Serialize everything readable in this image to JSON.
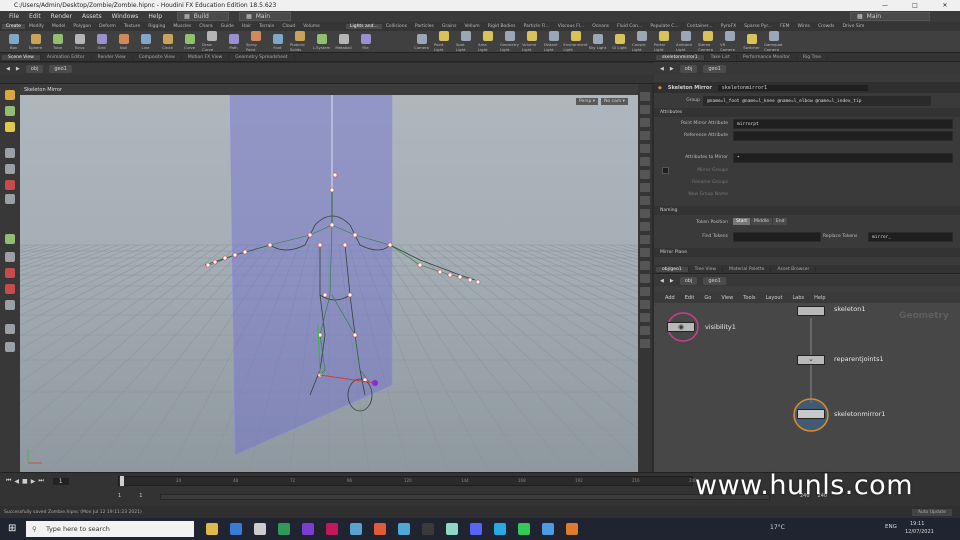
{
  "window": {
    "title": "C:/Users/Admin/Desktop/Zombie/Zombie.hipnc - Houdini FX Education Edition 18.5.623",
    "controls": [
      "—",
      "□",
      "✕"
    ]
  },
  "menubar": {
    "items": [
      "File",
      "Edit",
      "Render",
      "Assets",
      "Windows",
      "Help"
    ],
    "desktop_left": "Build",
    "desktop_right": "Main",
    "desktop_far": "Main"
  },
  "shelf": {
    "tabs": [
      "Create",
      "Modify",
      "Model",
      "Polygon",
      "Deform",
      "Texture",
      "Rigging",
      "Muscles",
      "Chara",
      "Guide",
      "Hair",
      "Terrain",
      "Cloud",
      "Volume"
    ],
    "light_tabs": [
      "Lights and...",
      "Collisions",
      "Particles",
      "Grains",
      "Vellum",
      "Rigid Bodies",
      "Particle Fl...",
      "Viscous Fl...",
      "Oceans",
      "Fluid Con...",
      "Populate C...",
      "Container...",
      "PyroFX",
      "Sparse Pyr...",
      "FEM",
      "Wires",
      "Crowds",
      "Drive Sim"
    ],
    "tools": [
      "Box",
      "Sphere",
      "Tube",
      "Torus",
      "Grid",
      "Null",
      "Line",
      "Circle",
      "Curve",
      "Draw Curve",
      "Path",
      "Spray Paint",
      "Font",
      "Platonic Solids",
      "L-System",
      "Metaball",
      "File"
    ],
    "light_tools": [
      "Camera",
      "Point Light",
      "Spot Light",
      "Area Light",
      "Geometry Light",
      "Volume Light",
      "Distant Light",
      "Environment Light",
      "Sky Light",
      "GI Light",
      "Caustic Light",
      "Portal Light",
      "Ambient Light",
      "Stereo Camera",
      "VR Camera",
      "Switcher",
      "Gamepad Camera"
    ]
  },
  "scene_tabs": [
    "Scene View",
    "Animation Editor",
    "Render View",
    "Composite View",
    "Motion FX View",
    "Geometry Spreadsheet"
  ],
  "scene_path": [
    "obj",
    "geo1"
  ],
  "viewport": {
    "title": "Skeleton Mirror",
    "persp": "Persp ▾",
    "cam": "No cam ▾"
  },
  "params": {
    "tabs": [
      "skeletonmirror1",
      "Take List",
      "Performance Monitor",
      "Rig Tree"
    ],
    "path": [
      "obj",
      "geo1"
    ],
    "node_type": "Skeleton Mirror",
    "node_name": "skeletonmirror1",
    "group_label": "Group",
    "group_value": "@name=l_foot @name=l_knee @name=l_elbow @name=l_index_tip",
    "attributes_section": "Attributes",
    "point_mirror_label": "Point Mirror Attribute",
    "point_mirror_value": "mirrorpt",
    "reference_label": "Reference Attribute",
    "attributes_to_mirror_label": "Attributes to Mirror",
    "attributes_to_mirror_value": "*",
    "mirror_groups_label": "Mirror Groups",
    "rename_groups_label": "Rename Groups",
    "new_group_name_label": "New Group Name",
    "naming_section": "Naming",
    "token_position_label": "Token Position",
    "token_options": [
      "Start",
      "Middle",
      "End"
    ],
    "find_tokens_label": "Find Tokens",
    "replace_tokens_label": "Replace Tokens",
    "replace_tokens_value": "mirror_",
    "mirror_plane_section": "Mirror Plane"
  },
  "network": {
    "tabs": [
      "obj/geo1",
      "Tree View",
      "Material Palette",
      "Asset Browser"
    ],
    "path": [
      "obj",
      "geo1"
    ],
    "menu": [
      "Add",
      "Edit",
      "Go",
      "View",
      "Tools",
      "Layout",
      "Labs",
      "Help"
    ],
    "context_label": "Geometry",
    "nodes": [
      "visibility1",
      "skeleton1",
      "reparentjoints1",
      "skeletonmirror1"
    ]
  },
  "timeline": {
    "frame": "1",
    "start": "1",
    "end": "1",
    "range_end_a": "240",
    "range_end_b": "240",
    "ticks": [
      "1",
      "24",
      "48",
      "72",
      "96",
      "120",
      "144",
      "168",
      "192",
      "216",
      "240"
    ],
    "auto_update": "Auto Update"
  },
  "status": {
    "message": "Successfully saved Zombie.hipnc (Mon Jul 12 19:11:23 2021)"
  },
  "taskbar": {
    "search_placeholder": "Type here to search",
    "weather": "17°C",
    "lang": "ENG",
    "time": "19:11",
    "date": "12/07/2021"
  },
  "watermark": "www.hunls.com",
  "colors": {
    "accent_orange": "#e08a2c",
    "selected_blue": "#2c8fd6",
    "mirror_plane": "#6f6fd0"
  }
}
